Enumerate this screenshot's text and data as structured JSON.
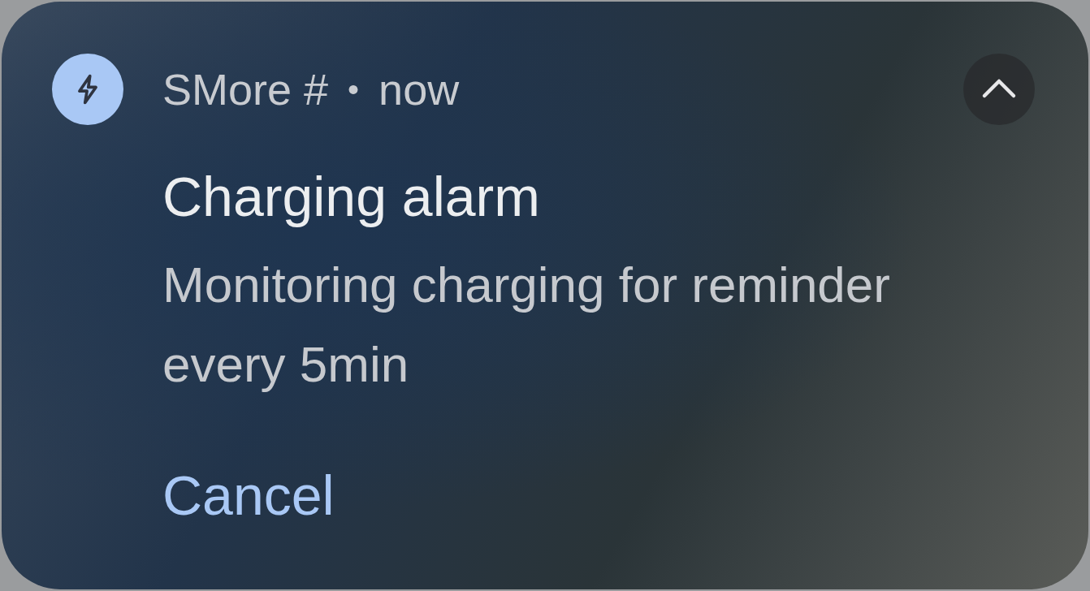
{
  "notification": {
    "app_name": "SMore #",
    "separator": "•",
    "time": "now",
    "expanded": true,
    "title": "Charging alarm",
    "body": "Monitoring charging for reminder every 5min",
    "actions": [
      {
        "label": "Cancel"
      }
    ]
  }
}
